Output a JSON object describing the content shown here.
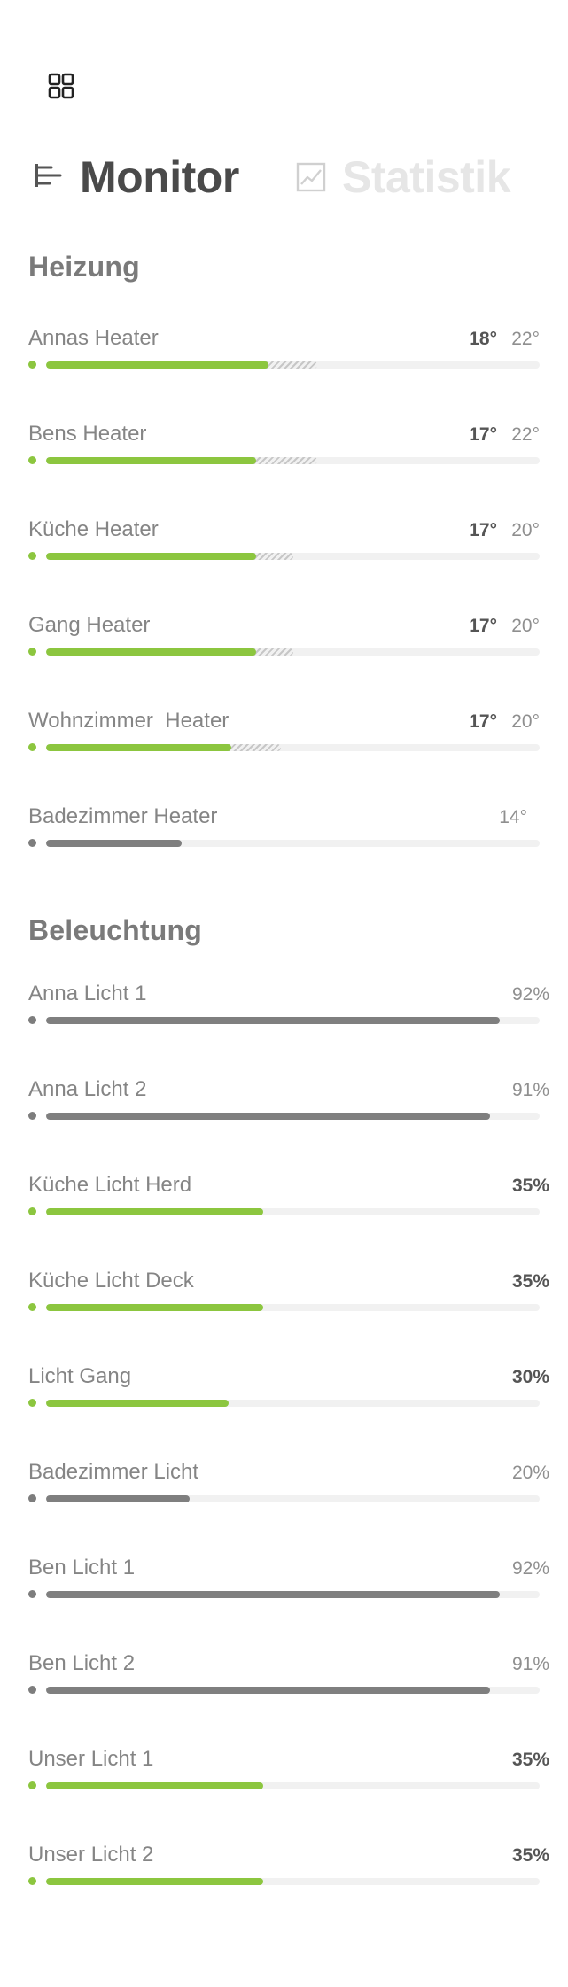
{
  "tabs": [
    {
      "label": "Monitor",
      "icon": "monitor-bars-icon",
      "active": true
    },
    {
      "label": "Statistik",
      "icon": "chart-line-icon",
      "active": false
    }
  ],
  "menu_icon": "grid-icon",
  "colors": {
    "active": "#8cc63f",
    "inactive": "#7f7f7f",
    "track": "#f1f1f1",
    "hatch": "#c7c7c7"
  },
  "heating": {
    "title": "Heizung",
    "scale_max_degrees": 40,
    "items": [
      {
        "name": "Annas Heater",
        "current": "18°",
        "target": "22°",
        "current_value": 18,
        "target_value": 22,
        "active": true
      },
      {
        "name": "Bens Heater",
        "current": "17°",
        "target": "22°",
        "current_value": 17,
        "target_value": 22,
        "active": true
      },
      {
        "name": "Küche Heater",
        "current": "17°",
        "target": "20°",
        "current_value": 17,
        "target_value": 20,
        "active": true
      },
      {
        "name": "Gang Heater",
        "current": "17°",
        "target": "20°",
        "current_value": 17,
        "target_value": 20,
        "active": true
      },
      {
        "name": "Wohnzimmer  Heater",
        "current": "17°",
        "target": "20°",
        "current_value": 15,
        "target_value": 19,
        "active": true
      },
      {
        "name": "Badezimmer Heater",
        "current": "",
        "target": "14°",
        "current_value": 11,
        "target_value": null,
        "active": false
      }
    ]
  },
  "lighting": {
    "title": "Beleuchtung",
    "items": [
      {
        "name": "Anna Licht 1",
        "value": "92%",
        "level": 0.92,
        "active": false
      },
      {
        "name": "Anna Licht 2",
        "value": "91%",
        "level": 0.9,
        "active": false
      },
      {
        "name": "Küche Licht Herd",
        "value": "35%",
        "level": 0.44,
        "active": true
      },
      {
        "name": "Küche Licht Deck",
        "value": "35%",
        "level": 0.44,
        "active": true
      },
      {
        "name": "Licht Gang",
        "value": "30%",
        "level": 0.37,
        "active": true
      },
      {
        "name": "Badezimmer Licht",
        "value": "20%",
        "level": 0.29,
        "active": false
      },
      {
        "name": "Ben Licht 1",
        "value": "92%",
        "level": 0.92,
        "active": false
      },
      {
        "name": "Ben Licht 2",
        "value": "91%",
        "level": 0.9,
        "active": false
      },
      {
        "name": "Unser Licht 1",
        "value": "35%",
        "level": 0.44,
        "active": true
      },
      {
        "name": "Unser Licht 2",
        "value": "35%",
        "level": 0.44,
        "active": true
      }
    ]
  }
}
